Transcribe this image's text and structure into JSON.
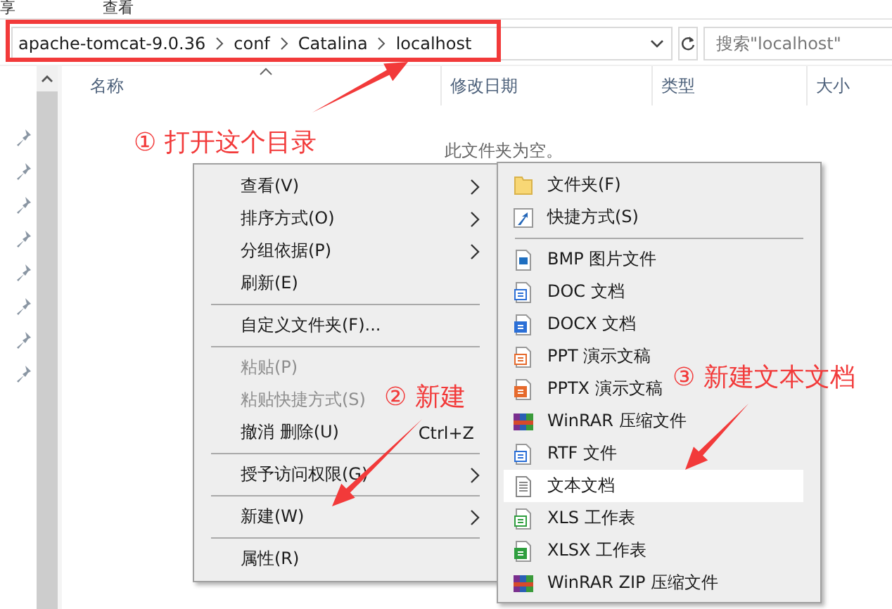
{
  "ribbon_tabs": [
    "享",
    "查看"
  ],
  "address_bar": {
    "path": [
      "apache-tomcat-9.0.36",
      "conf",
      "Catalina",
      "localhost"
    ]
  },
  "search": {
    "placeholder": "搜索\"localhost\""
  },
  "columns": [
    "名称",
    "修改日期",
    "类型",
    "大小"
  ],
  "nav_items": [
    {
      "pinned": true
    },
    {
      "pinned": true
    },
    {
      "pinned": true
    },
    {
      "pinned": true
    },
    {
      "pinned": true
    },
    {
      "pinned": true
    },
    {
      "pinned": true
    },
    {
      "pinned": true
    }
  ],
  "empty_message": "此文件夹为空。",
  "context_menu": {
    "items": [
      {
        "kind": "item",
        "label": "查看(V)",
        "submenu": true,
        "disabled": false
      },
      {
        "kind": "item",
        "label": "排序方式(O)",
        "submenu": true,
        "disabled": false
      },
      {
        "kind": "item",
        "label": "分组依据(P)",
        "submenu": true,
        "disabled": false
      },
      {
        "kind": "item",
        "label": "刷新(E)",
        "submenu": false,
        "disabled": false
      },
      {
        "kind": "separator"
      },
      {
        "kind": "item",
        "label": "自定义文件夹(F)...",
        "submenu": false,
        "disabled": false
      },
      {
        "kind": "separator"
      },
      {
        "kind": "item",
        "label": "粘贴(P)",
        "submenu": false,
        "disabled": true
      },
      {
        "kind": "item",
        "label": "粘贴快捷方式(S)",
        "submenu": false,
        "disabled": true
      },
      {
        "kind": "item",
        "label": "撤消 删除(U)",
        "shortcut": "Ctrl+Z",
        "submenu": false,
        "disabled": false
      },
      {
        "kind": "separator"
      },
      {
        "kind": "item",
        "label": "授予访问权限(G)",
        "submenu": true,
        "disabled": false
      },
      {
        "kind": "separator"
      },
      {
        "kind": "item",
        "label": "新建(W)",
        "submenu": true,
        "disabled": false
      },
      {
        "kind": "separator"
      },
      {
        "kind": "item",
        "label": "属性(R)",
        "submenu": false,
        "disabled": false
      }
    ]
  },
  "new_submenu": {
    "items": [
      {
        "kind": "folder",
        "label": "文件夹(F)",
        "selected": false
      },
      {
        "kind": "shortcut",
        "label": "快捷方式(S)",
        "selected": false
      },
      {
        "kind": "separator"
      },
      {
        "kind": "bmp",
        "label": "BMP 图片文件",
        "selected": false
      },
      {
        "kind": "doc",
        "label": "DOC 文档",
        "selected": false
      },
      {
        "kind": "docx",
        "label": "DOCX 文档",
        "selected": false
      },
      {
        "kind": "ppt",
        "label": "PPT 演示文稿",
        "selected": false
      },
      {
        "kind": "pptx",
        "label": "PPTX 演示文稿",
        "selected": false
      },
      {
        "kind": "rar",
        "label": "WinRAR 压缩文件",
        "selected": false
      },
      {
        "kind": "rtf",
        "label": "RTF 文件",
        "selected": false
      },
      {
        "kind": "txt",
        "label": "文本文档",
        "selected": true
      },
      {
        "kind": "xls",
        "label": "XLS 工作表",
        "selected": false
      },
      {
        "kind": "xlsx",
        "label": "XLSX 工作表",
        "selected": false
      },
      {
        "kind": "rar",
        "label": "WinRAR ZIP 压缩文件",
        "selected": false
      }
    ]
  },
  "annotations": [
    {
      "text": "① 打开这个目录"
    },
    {
      "text": "② 新建"
    },
    {
      "text": "③ 新建文本文档"
    }
  ]
}
